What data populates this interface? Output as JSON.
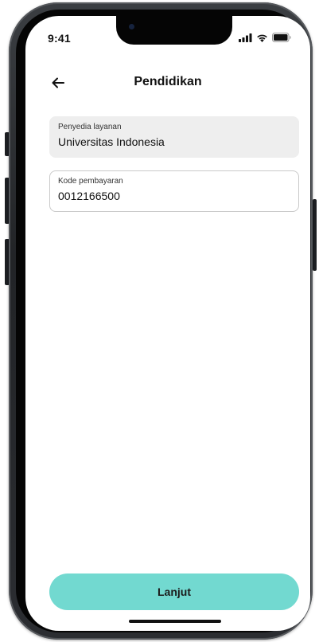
{
  "status_bar": {
    "time": "9:41",
    "icons": [
      "cellular-signal-icon",
      "wifi-icon",
      "battery-icon"
    ]
  },
  "header": {
    "back_icon": "arrow-left-icon",
    "title": "Pendidikan"
  },
  "form": {
    "provider": {
      "label": "Penyedia layanan",
      "value": "Universitas Indonesia"
    },
    "payment_code": {
      "label": "Kode pembayaran",
      "value": "0012166500"
    }
  },
  "actions": {
    "continue_label": "Lanjut"
  },
  "colors": {
    "primary_button": "#72d9d0",
    "disabled_field_bg": "#eeeeee",
    "input_border": "#c9c9c9",
    "device_frame": "#222427"
  }
}
